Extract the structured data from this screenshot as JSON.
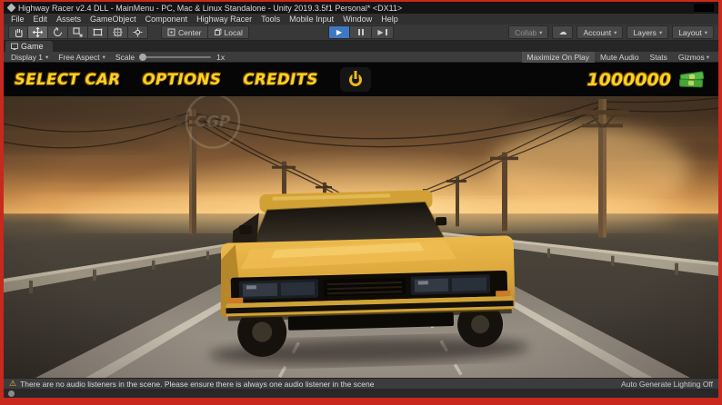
{
  "titlebar": {
    "title": "Highway Racer v2.4 DLL - MainMenu - PC, Mac & Linux Standalone - Unity 2019.3.5f1 Personal* <DX11>"
  },
  "menubar": {
    "items": [
      "File",
      "Edit",
      "Assets",
      "GameObject",
      "Component",
      "Highway Racer",
      "Tools",
      "Mobile Input",
      "Window",
      "Help"
    ]
  },
  "toolbar": {
    "pivot": "Center",
    "space": "Local",
    "collab": "Collab",
    "account": "Account",
    "layers": "Layers",
    "layout": "Layout"
  },
  "tabs": {
    "game": "Game"
  },
  "game_toolbar": {
    "display": "Display 1",
    "aspect": "Free Aspect",
    "scale_label": "Scale",
    "scale_value": "1x",
    "maximize": "Maximize On Play",
    "mute": "Mute Audio",
    "stats": "Stats",
    "gizmos": "Gizmos"
  },
  "game_ui": {
    "menu": [
      {
        "label": "SELECT CAR"
      },
      {
        "label": "OPTIONS"
      },
      {
        "label": "CREDITS"
      }
    ],
    "money": "1000000",
    "watermark": "CGP",
    "accent_yellow": "#ffd125"
  },
  "icons": {
    "caret": "▾",
    "cloud": "☁",
    "play": "▶",
    "warning": "⚠"
  },
  "statusbar": {
    "message": "There are no audio listeners in the scene. Please ensure there is always one audio listener in the scene",
    "lighting": "Auto Generate Lighting Off"
  }
}
